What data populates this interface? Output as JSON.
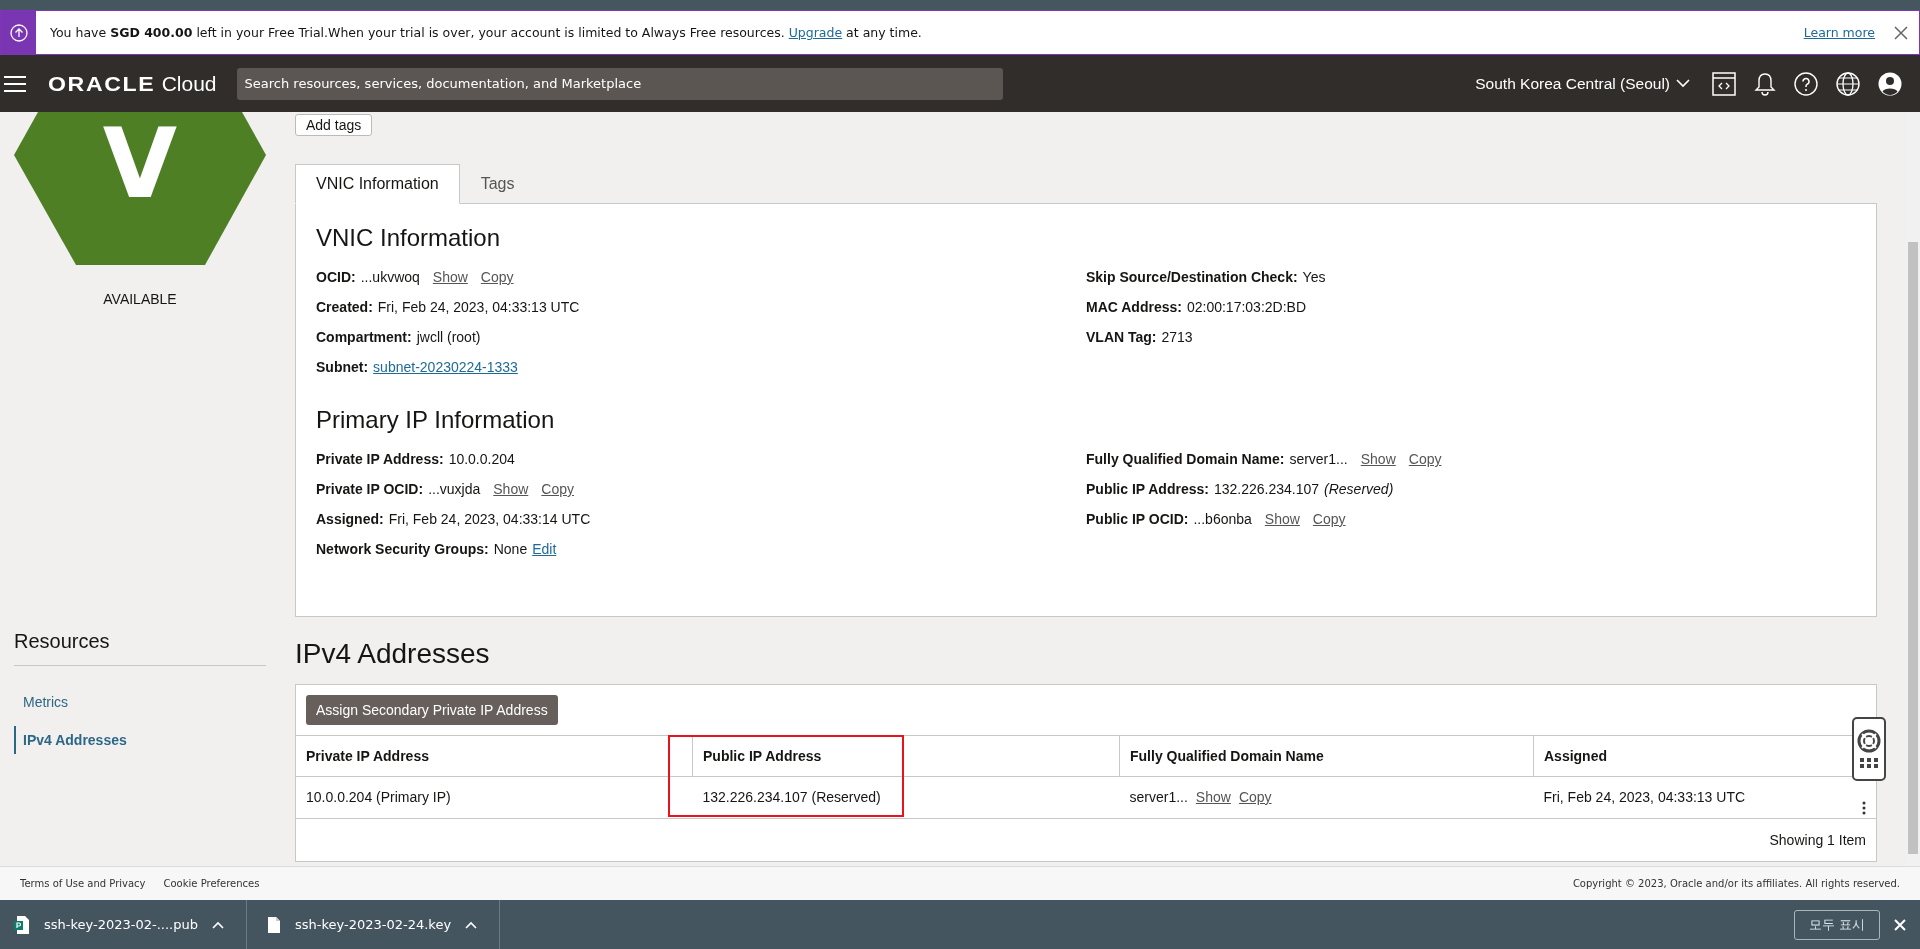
{
  "banner": {
    "text": "You have **SGD 400.00** left in your Free Trial.When your trial is over, your account is limited to Always Free resources.",
    "link": "Upgrade",
    "text_after": "at any time.",
    "learn_more": "Learn more"
  },
  "header": {
    "logo": "ORACLE",
    "logo_suffix": "Cloud",
    "search": {
      "placeholder": "Search resources, services, documentation, and Marketplace"
    },
    "region": "South Korea Central (Seoul)"
  },
  "resource": {
    "letter": "V",
    "status": "AVAILABLE",
    "add_tags": "Add tags"
  },
  "tabs": [
    {
      "label": "VNIC Information",
      "selected": true
    },
    {
      "label": "Tags",
      "selected": false
    }
  ],
  "sections": [
    {
      "title": "VNIC Information",
      "left": [
        {
          "label": "OCID:",
          "value": "...ukvwoq",
          "actions": [
            "Show",
            "Copy"
          ]
        },
        {
          "label": "Created:",
          "value": "Fri, Feb 24, 2023, 04:33:13 UTC"
        },
        {
          "label": "Compartment:",
          "value": "jwcll (root)"
        },
        {
          "label": "Subnet:",
          "link": "subnet-20230224-1333"
        }
      ],
      "right": [
        {
          "label": "Skip Source/Destination Check:",
          "value": "Yes"
        },
        {
          "label": "MAC Address:",
          "value": "02:00:17:03:2D:BD"
        },
        {
          "label": "VLAN Tag:",
          "value": "2713"
        }
      ]
    },
    {
      "title": "Primary IP Information",
      "left": [
        {
          "label": "Private IP Address:",
          "value": "10.0.0.204"
        },
        {
          "label": "Private IP OCID:",
          "value": "...vuxjda",
          "actions": [
            "Show",
            "Copy"
          ]
        },
        {
          "label": "Assigned:",
          "value": "Fri, Feb 24, 2023, 04:33:14 UTC"
        },
        {
          "label": "Network Security Groups:",
          "value": "None",
          "link": "Edit"
        }
      ],
      "right": [
        {
          "label": "Fully Qualified Domain Name:",
          "value": "server1...",
          "actions": [
            "Show",
            "Copy"
          ]
        },
        {
          "label": "Public IP Address:",
          "value": "132.226.234.107",
          "note": "(Reserved)"
        },
        {
          "label": "Public IP OCID:",
          "value": "...b6onba",
          "actions": [
            "Show",
            "Copy"
          ]
        }
      ]
    }
  ],
  "resources": {
    "title": "Resources",
    "items": [
      {
        "label": "Metrics",
        "selected": false
      },
      {
        "label": "IPv4 Addresses",
        "selected": true
      }
    ]
  },
  "ipv4": {
    "title": "IPv4 Addresses",
    "button": "Assign Secondary Private IP Address",
    "columns": [
      {
        "label": "Private IP Address",
        "highlighted": false
      },
      {
        "label": "Public IP Address",
        "highlighted": true
      },
      {
        "label": "Fully Qualified Domain Name",
        "highlighted": false
      },
      {
        "label": "Assigned",
        "highlighted": false
      }
    ],
    "rows": [
      {
        "cells": [
          {
            "text": "10.0.0.204 (Primary IP)"
          },
          {
            "text": "132.226.234.107 (Reserved)"
          },
          {
            "text": "server1...",
            "actions": [
              "Show",
              "Copy"
            ]
          },
          {
            "text": "Fri, Feb 24, 2023, 04:33:13 UTC"
          }
        ]
      }
    ],
    "footer": "Showing 1 Item"
  },
  "footer": {
    "links": [
      "Terms of Use and Privacy",
      "Cookie Preferences"
    ],
    "copyright": "Copyright © 2023, Oracle and/or its affiliates. All rights reserved."
  },
  "downloads": {
    "items": [
      {
        "name": "ssh-key-2023-02-....pub",
        "kind": "spreadsheet"
      },
      {
        "name": "ssh-key-2023-02-24.key",
        "kind": "file"
      }
    ],
    "show_all": "모두 표시"
  }
}
